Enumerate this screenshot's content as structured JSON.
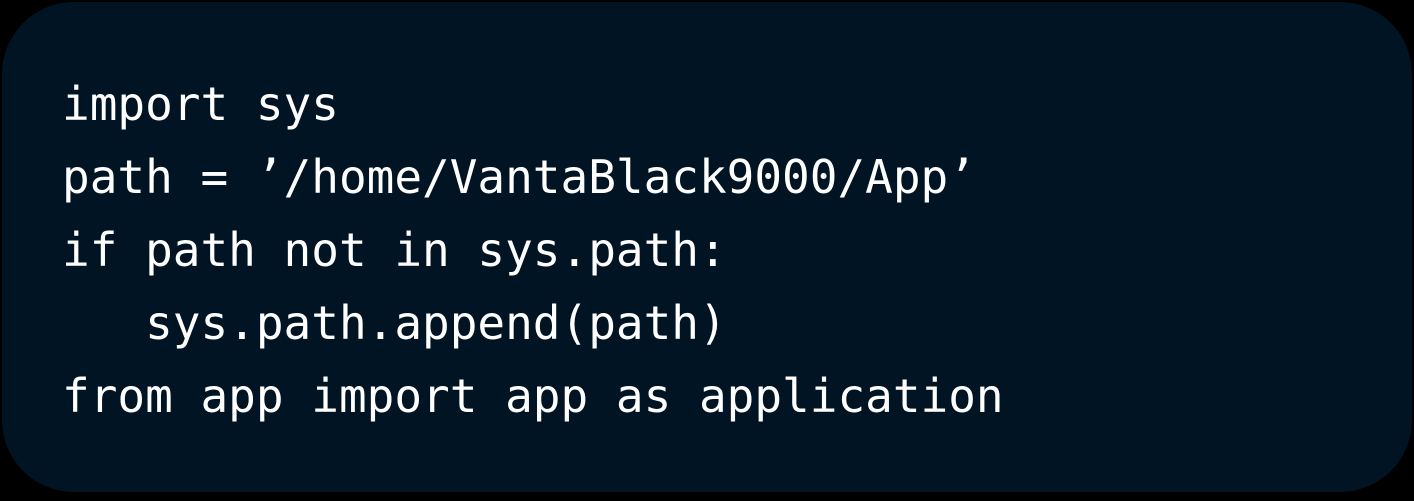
{
  "colors": {
    "background": "#000000",
    "card": "#011424",
    "text": "#FFFFFF"
  },
  "code": {
    "language": "python",
    "lines": [
      "import sys",
      "path = ’/home/VantaBlack9000/App’",
      "if path not in sys.path:",
      "   sys.path.append(path)",
      "from app import app as application"
    ]
  }
}
